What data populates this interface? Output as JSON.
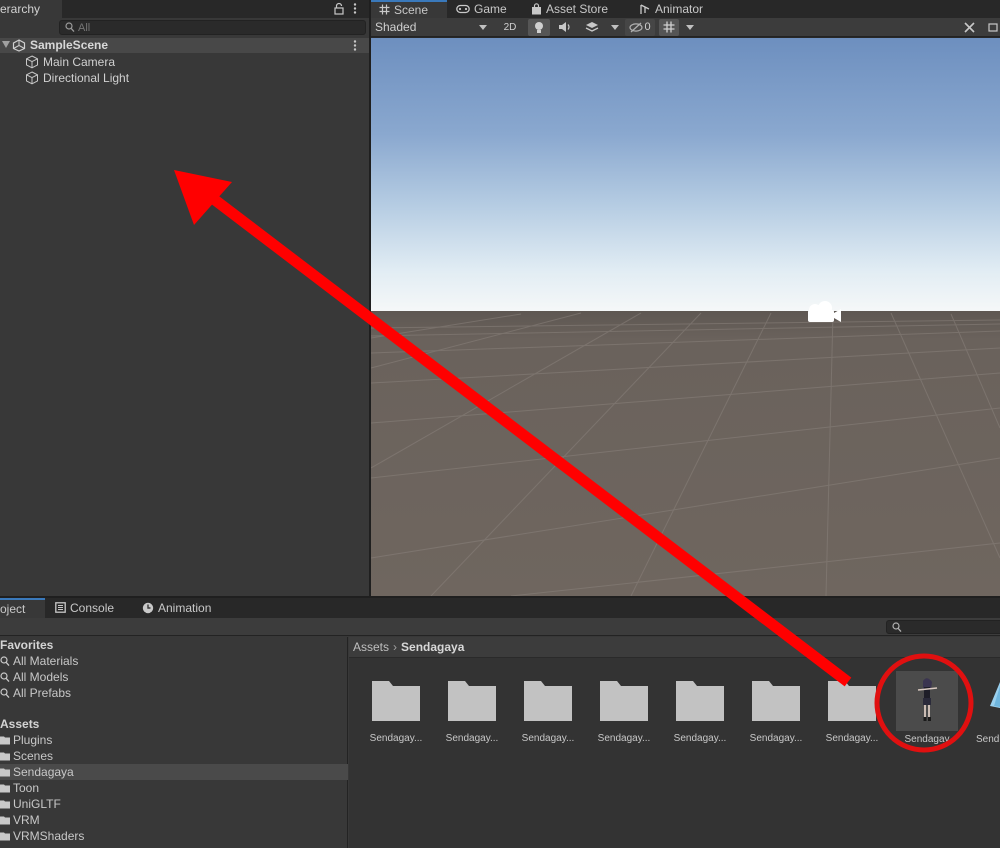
{
  "hierarchy": {
    "tab_label": "erarchy",
    "search_placeholder": "All",
    "scene_name": "SampleScene",
    "items": [
      {
        "label": "Main Camera"
      },
      {
        "label": "Directional Light"
      }
    ]
  },
  "scene_window": {
    "tabs": [
      {
        "label": "Scene",
        "icon": "grid-icon"
      },
      {
        "label": "Game",
        "icon": "gamepad-icon"
      },
      {
        "label": "Asset Store",
        "icon": "bag-icon"
      },
      {
        "label": "Animator",
        "icon": "animator-icon"
      }
    ],
    "toolbar": {
      "draw_mode": "Shaded",
      "mode_2d": "2D",
      "hidden_count": "0"
    }
  },
  "bottom": {
    "tabs": [
      {
        "label": "oject",
        "icon": "folder-icon"
      },
      {
        "label": "Console",
        "icon": "console-icon"
      },
      {
        "label": "Animation",
        "icon": "clock-icon"
      }
    ],
    "favorites": {
      "heading": "Favorites",
      "items": [
        {
          "label": "All Materials"
        },
        {
          "label": "All Models"
        },
        {
          "label": "All Prefabs"
        }
      ]
    },
    "assets": {
      "heading": "Assets",
      "items": [
        {
          "label": "Plugins",
          "selected": false
        },
        {
          "label": "Scenes",
          "selected": false
        },
        {
          "label": "Sendagaya",
          "selected": true
        },
        {
          "label": "Toon",
          "selected": false
        },
        {
          "label": "UniGLTF",
          "selected": false
        },
        {
          "label": "VRM",
          "selected": false
        },
        {
          "label": "VRMShaders",
          "selected": false
        }
      ]
    },
    "breadcrumb": {
      "root": "Assets",
      "current": "Sendagaya"
    },
    "tiles": [
      {
        "label": "Sendagay..."
      },
      {
        "label": "Sendagay..."
      },
      {
        "label": "Sendagay..."
      },
      {
        "label": "Sendagay..."
      },
      {
        "label": "Sendagay..."
      },
      {
        "label": "Sendagay..."
      },
      {
        "label": "Sendagay..."
      },
      {
        "label": "Sendagay"
      },
      {
        "label": "Send"
      }
    ]
  },
  "annotation": {
    "arrow_color": "#ff0000",
    "circle_color": "#e01010"
  }
}
